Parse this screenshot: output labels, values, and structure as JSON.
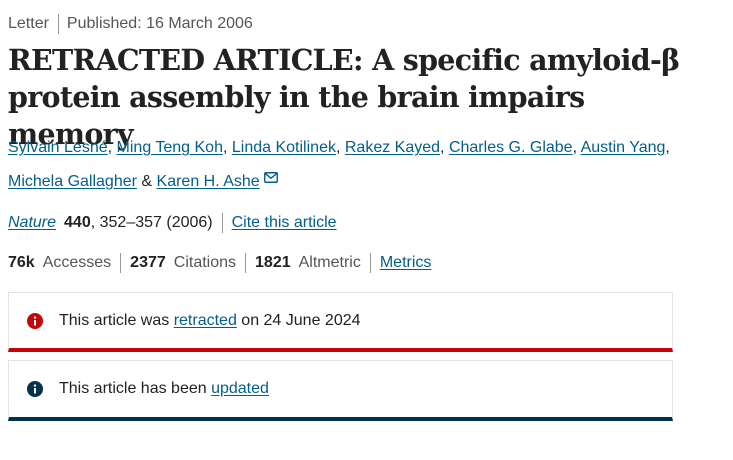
{
  "header": {
    "article_type": "Letter",
    "published": "Published: 16 March 2006"
  },
  "article": {
    "title": "RETRACTED ARTICLE: A specific amyloid-β protein assembly in the brain impairs memory"
  },
  "authors": {
    "list": [
      "Sylvain Lesné",
      "Ming Teng Koh",
      "Linda Kotilinek",
      "Rakez Kayed",
      "Charles G. Glabe",
      "Austin Yang",
      "Michela Gallagher",
      "Karen H. Ashe"
    ],
    "separator": ",",
    "conjunction": "&",
    "corresponding_icon": "mail-icon"
  },
  "citation": {
    "journal": "Nature",
    "volume": "440",
    "pages_year": ", 352–357 (2006)",
    "cite_link": "Cite this article"
  },
  "metrics": {
    "accesses_value": "76k",
    "accesses_label": "Accesses",
    "citations_value": "2377",
    "citations_label": "Citations",
    "altmetric_value": "1821",
    "altmetric_label": "Altmetric",
    "metrics_link": "Metrics"
  },
  "notices": {
    "retracted": {
      "icon": "info-icon",
      "color": "#c40606",
      "text_before": "This article was ",
      "link": "retracted",
      "text_after": " on 24 June 2024"
    },
    "updated": {
      "icon": "info-icon",
      "color": "#01324b",
      "text_before": "This article has been ",
      "link": "updated"
    }
  },
  "colors": {
    "link": "#025e8d",
    "text": "#222222",
    "muted": "#555555"
  }
}
